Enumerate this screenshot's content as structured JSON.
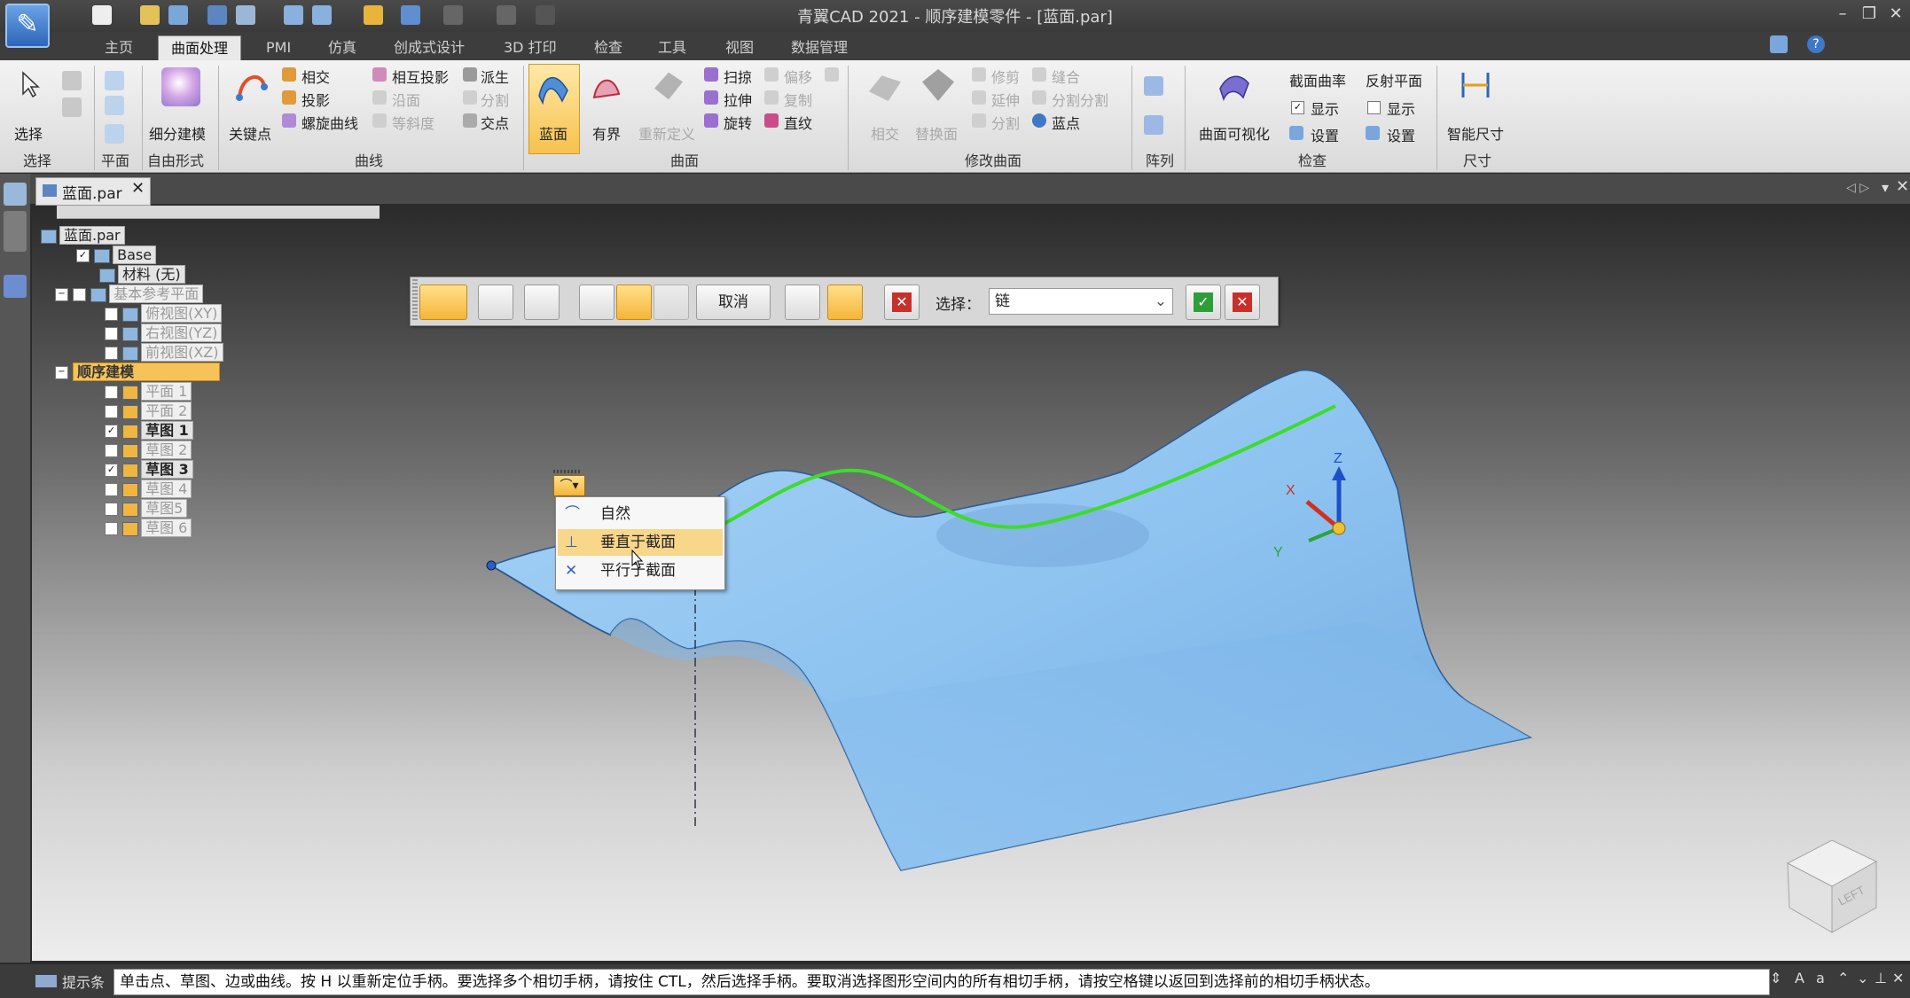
{
  "window": {
    "title": "青翼CAD 2021 - 顺序建模零件 - [蓝面.par]"
  },
  "tabs": [
    "主页",
    "曲面处理",
    "PMI",
    "仿真",
    "创成式设计",
    "3D 打印",
    "检查",
    "工具",
    "视图",
    "数据管理"
  ],
  "active_tab": "曲面处理",
  "ribbon": {
    "select": {
      "label": "选择",
      "group": "选择"
    },
    "plane": {
      "group": "平面"
    },
    "freeform": {
      "label": "细分建模",
      "group": "自由形式"
    },
    "curves": {
      "group": "曲线",
      "keypoint": "关键点",
      "items": [
        "相交",
        "投影",
        "螺旋曲线",
        "相互投影",
        "派生",
        "沿面",
        "分割",
        "等斜度",
        "交点"
      ]
    },
    "surfaces": {
      "group": "曲面",
      "bluesurf": "蓝面",
      "bounded": "有界",
      "items": [
        "扫掠",
        "拉伸",
        "旋转",
        "偏移",
        "复制",
        "直纹",
        "重新定义"
      ]
    },
    "modify": {
      "group": "修改曲面",
      "items": [
        "相交",
        "替换面",
        "修剪",
        "缝合",
        "延伸",
        "分割",
        "分割分割",
        "蓝点"
      ]
    },
    "pattern": {
      "group": "阵列"
    },
    "inspect": {
      "group": "检查",
      "visualize": "曲面可视化",
      "curvature": "截面曲率",
      "reflect": "反射平面",
      "show": "显示",
      "settings": "设置"
    },
    "dims": {
      "label": "智能尺寸",
      "group": "尺寸"
    }
  },
  "document_tab": "蓝面.par",
  "tree": {
    "root": "蓝面.par",
    "base": "Base",
    "material": "材料 (无)",
    "ref_planes": "基本参考平面",
    "planes": [
      "俯视图(XY)",
      "右视图(YZ)",
      "前视图(XZ)"
    ],
    "ordered": "顺序建模",
    "features": [
      {
        "label": "平面 1",
        "checked": false,
        "bold": false
      },
      {
        "label": "平面 2",
        "checked": false,
        "bold": false
      },
      {
        "label": "草图 1",
        "checked": true,
        "bold": true
      },
      {
        "label": "草图 2",
        "checked": false,
        "bold": false
      },
      {
        "label": "草图 3",
        "checked": true,
        "bold": true
      },
      {
        "label": "草图 4",
        "checked": false,
        "bold": false
      },
      {
        "label": "草图5",
        "checked": false,
        "bold": false
      },
      {
        "label": "草图 6",
        "checked": false,
        "bold": false
      }
    ]
  },
  "command_bar": {
    "cancel": "取消",
    "select_label": "选择：",
    "select_value": "链"
  },
  "popup_menu": {
    "items": [
      "自然",
      "垂直于截面",
      "平行于截面"
    ],
    "highlighted": 1
  },
  "triad": {
    "x": "X",
    "y": "Y",
    "z": "Z"
  },
  "viewcube": {
    "face": "LEFT"
  },
  "status": {
    "label": "提示条",
    "prompt": "单击点、草图、边或曲线。按 H 以重新定位手柄。要选择多个相切手柄，请按住 CTL，然后选择手柄。要取消选择图形空间内的所有相切手柄，请按空格键以返回到选择前的相切手柄状态。"
  },
  "colors": {
    "surface": "#8ec3f0",
    "curve": "#3ddc2a",
    "highlight": "#f8d68a",
    "accent": "#f5b53b"
  }
}
